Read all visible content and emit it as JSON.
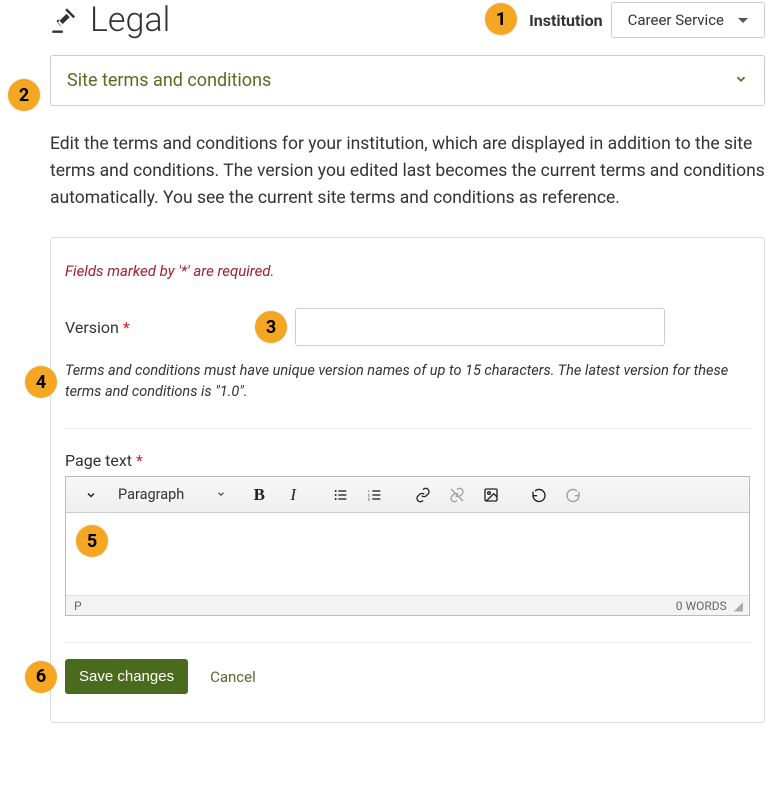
{
  "header": {
    "title": "Legal",
    "institution_label": "Institution",
    "institution_value": "Career Service"
  },
  "accordion": {
    "title": "Site terms and conditions"
  },
  "intro": "Edit the terms and conditions for your institution, which are displayed in addition to the site terms and conditions. The version you edited last becomes the current terms and conditions automatically. You see the current site terms and conditions as reference.",
  "form": {
    "required_note": "Fields marked by '*' are required.",
    "version_label": "Version",
    "version_value": "",
    "version_help": "Terms and conditions must have unique version names of up to 15 characters. The latest version for these terms and conditions is \"1.0\".",
    "pagetext_label": "Page text"
  },
  "editor": {
    "format_label": "Paragraph",
    "status_path": "P",
    "word_count": "0 WORDS"
  },
  "actions": {
    "save": "Save changes",
    "cancel": "Cancel"
  },
  "callouts": {
    "1": "1",
    "2": "2",
    "3": "3",
    "4": "4",
    "5": "5",
    "6": "6"
  }
}
